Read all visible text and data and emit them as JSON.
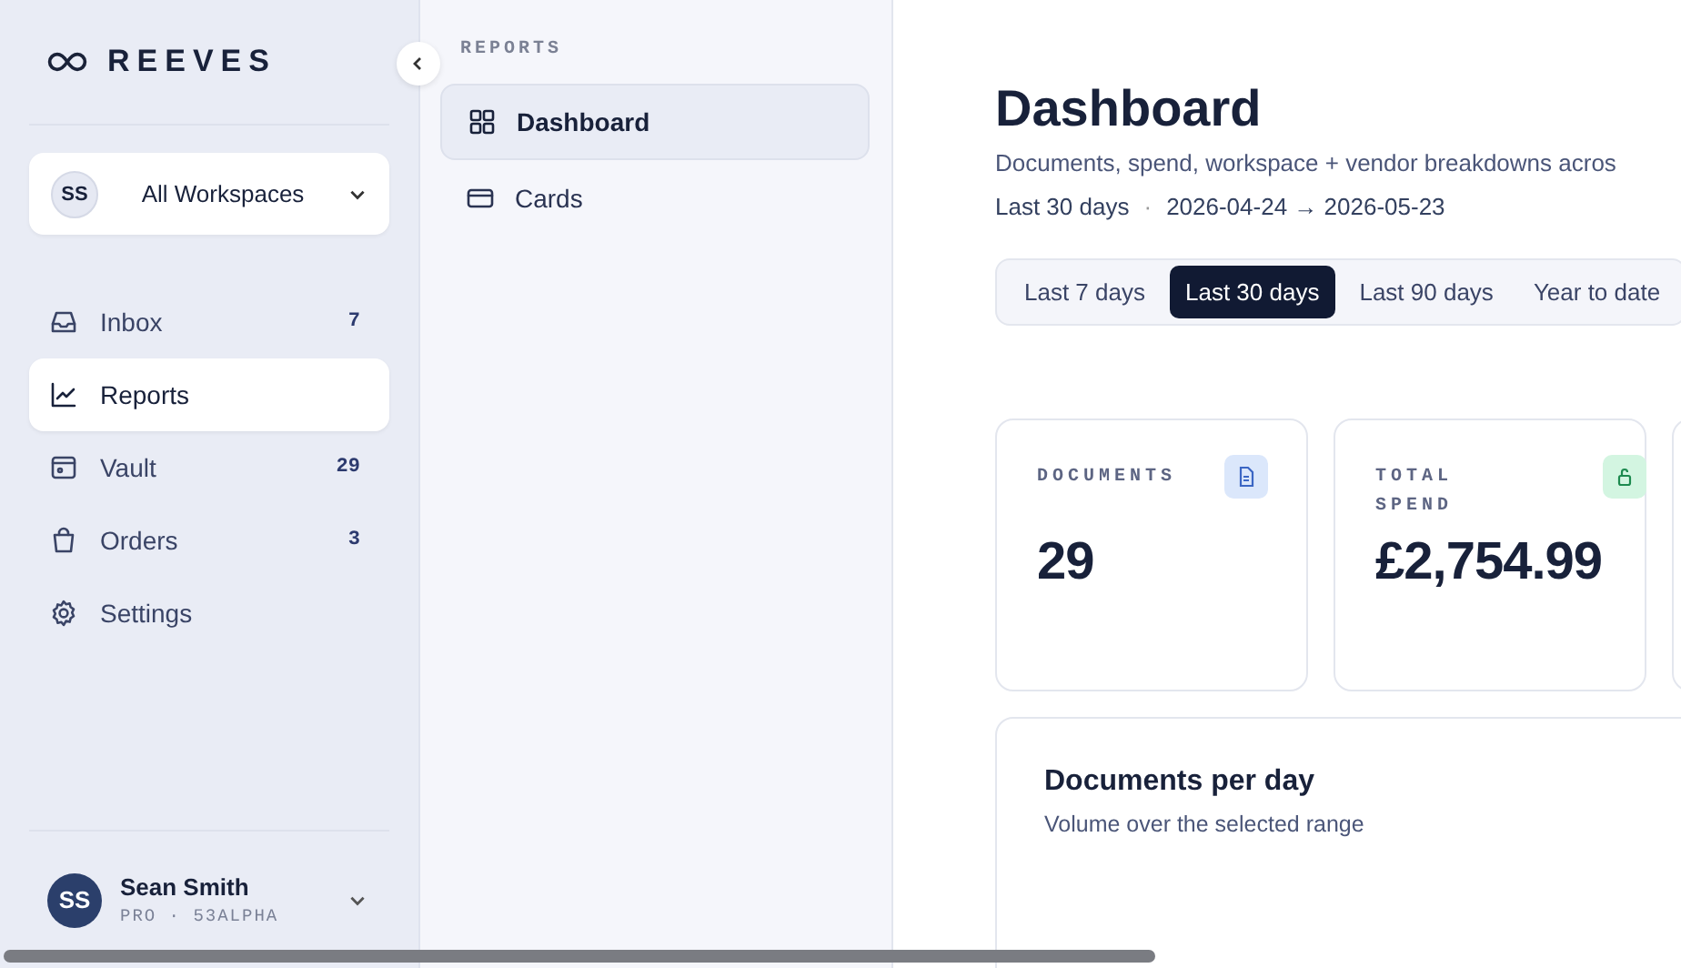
{
  "brand": {
    "name": "REEVES"
  },
  "workspace": {
    "initials": "SS",
    "label": "All Workspaces"
  },
  "nav": [
    {
      "label": "Inbox",
      "kind": "inbox",
      "count": "7",
      "selected": false
    },
    {
      "label": "Reports",
      "kind": "chart",
      "selected": true
    },
    {
      "label": "Vault",
      "kind": "vault",
      "count": "29",
      "selected": false
    },
    {
      "label": "Orders",
      "kind": "bag",
      "count": "3",
      "selected": false
    },
    {
      "label": "Settings",
      "kind": "gear",
      "selected": false
    }
  ],
  "user": {
    "initials": "SS",
    "name": "Sean Smith",
    "plan": "PRO · 53ALPHA"
  },
  "subnav": {
    "heading": "REPORTS",
    "items": [
      {
        "label": "Dashboard",
        "kind": "grid",
        "selected": true
      },
      {
        "label": "Cards",
        "kind": "card",
        "selected": false
      }
    ]
  },
  "page": {
    "title": "Dashboard",
    "subtitle": "Documents, spend, workspace + vendor breakdowns acros",
    "range_label": "Last 30 days",
    "separator": "·",
    "range": "2026-04-24 → 2026-05-23"
  },
  "ranges": [
    {
      "label": "Last 7 days",
      "selected": false
    },
    {
      "label": "Last 30 days",
      "selected": true
    },
    {
      "label": "Last 90 days",
      "selected": false
    },
    {
      "label": "Year to date",
      "selected": false
    }
  ],
  "stats": [
    {
      "label": "DOCUMENTS",
      "value": "29",
      "kind": "doc",
      "color": "#dbe7fb"
    },
    {
      "label": "TOTAL SPEND",
      "value": "£2,754.99",
      "kind": "lock",
      "color": "#d3f5e1"
    }
  ],
  "panel": {
    "title": "Documents per day",
    "subtitle": "Volume over the selected range"
  }
}
